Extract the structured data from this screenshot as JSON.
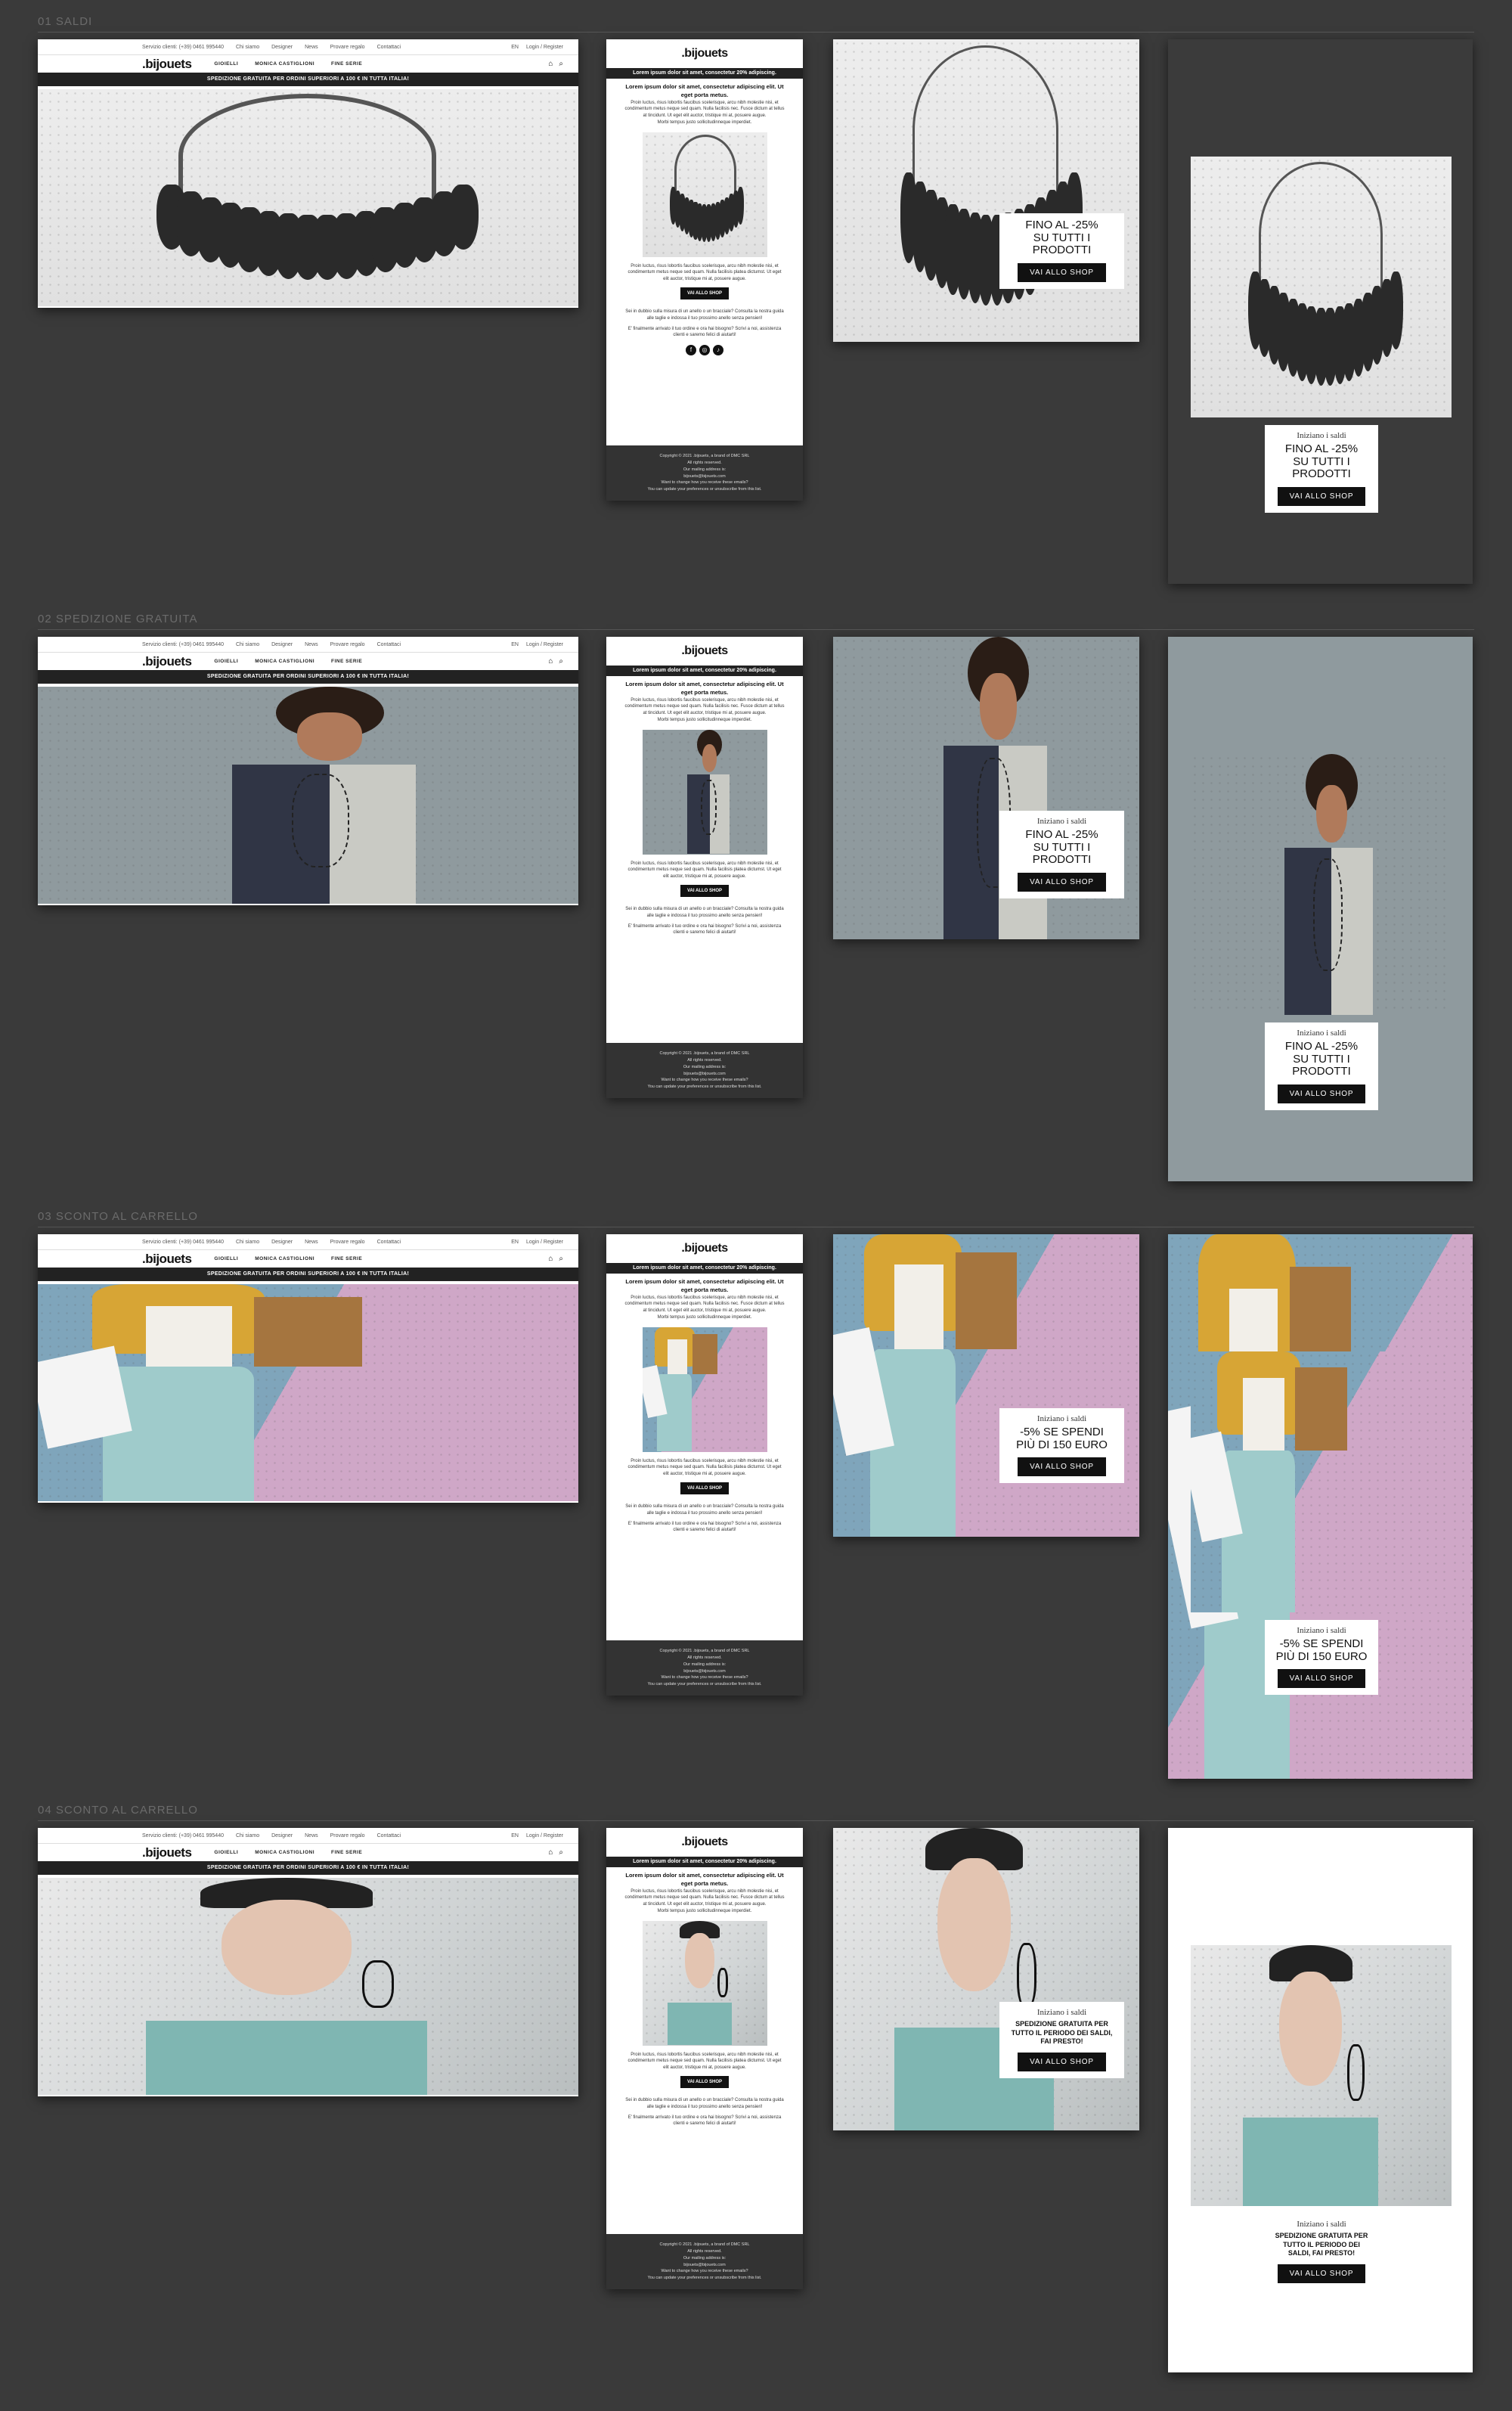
{
  "sections": [
    {
      "title": "01 SALDI"
    },
    {
      "title": "02 SPEDIZIONE GRATUITA"
    },
    {
      "title": "03 SCONTO AL CARRELLO"
    },
    {
      "title": "04 SCONTO AL CARRELLO"
    }
  ],
  "desktop": {
    "topbar": {
      "service": "Servizio clienti: (+39) 0461 995440",
      "links": [
        "Chi siamo",
        "Designer",
        "News",
        "Provare regalo",
        "Contattaci"
      ],
      "lang": "EN",
      "account": "Login / Register"
    },
    "logo": ".bijouets",
    "nav": [
      "GIOIELLI",
      "MONICA CASTIGLIONI",
      "FINE SERIE"
    ],
    "ship_bar": "SPEDIZIONE GRATUITA PER ORDINI SUPERIORI A 100 € IN TUTTA ITALIA!"
  },
  "email": {
    "logo": ".bijouets",
    "bar": "Lorem ipsum dolor sit amet, consectetur 20% adipiscing.",
    "lead": "Lorem ipsum dolor sit amet, consectetur adipiscing elit. Ut eget porta metus.",
    "p1": "Proin luctus, risus lobortis faucibus scelerisque, arcu nibh molestie nisi, et condimentum metus neque sed quam. Nulla facilisis nec. Fusce dictum at tellus at tincidunt. Ut eget elit auctor, tristique mi at, posuere augue.",
    "p2": "Morbi tempus justo sollicitudinneque imperdiet.",
    "p3": "Proin luctus, risus lobortis faucibus scelerisque, arcu nibh molestie nisi, et condimentum metus neque sed quam. Nulla facilisis platea dictumst. Ut eget elit auctor, tristique mi at, posuere augue.",
    "button": "VAI ALLO SHOP",
    "help": "Sei in dubbio sulla misura di un anello o un bracciale? Consulta la nostra guida alle taglie e indossa il tuo prossimo anello senza pensieri!",
    "note": "E' finalmente arrivato il tuo ordine e ora hai bisogno? Scrivi a noi, assistenza clienti e saremo felici di aiutarti!",
    "social": [
      "f",
      "◎",
      "♪"
    ],
    "footer": {
      "copyright": "Copyright © 2021 .bijouets, a brand of DMC SRL",
      "rights": "All rights reserved.",
      "mailing": "Our mailing address is:",
      "email": "bijouets@bijouets.com",
      "change": "Want to change how you receive these emails?",
      "update": "You can update your preferences or unsubscribe from this list."
    }
  },
  "promos": [
    {
      "inizio": "",
      "head": "FINO AL -25%",
      "sub": "SU TUTTI I PRODOTTI",
      "button": "VAI ALLO SHOP"
    },
    {
      "inizio": "Iniziano i saldi",
      "head": "FINO AL -25%",
      "sub": "SU TUTTI I PRODOTTI",
      "button": "VAI ALLO SHOP"
    },
    {
      "inizio": "Iniziano i saldi",
      "head": "FINO AL -25%",
      "sub": "SU TUTTI I PRODOTTI",
      "button": "VAI ALLO SHOP"
    },
    {
      "inizio": "Iniziano i saldi",
      "head": "FINO AL -25%",
      "sub": "SU TUTTI I PRODOTTI",
      "button": "VAI ALLO SHOP"
    },
    {
      "inizio": "Iniziano i saldi",
      "head": "-5% SE SPENDI",
      "sub": "PIÙ DI 150 EURO",
      "button": "VAI ALLO SHOP"
    },
    {
      "inizio": "Iniziano i saldi",
      "head": "-5% SE SPENDI",
      "sub": "PIÙ DI 150 EURO",
      "button": "VAI ALLO SHOP"
    },
    {
      "inizio": "Iniziano i saldi",
      "head": "SPEDIZIONE GRATUITA PER TUTTO IL PERIODO DEI SALDI, FAI PRESTO!",
      "sub": "",
      "button": "VAI ALLO SHOP"
    },
    {
      "inizio": "Iniziano i saldi",
      "head": "SPEDIZIONE GRATUITA PER TUTTO IL PERIODO DEI SALDI, FAI PRESTO!",
      "sub": "",
      "button": "VAI ALLO SHOP"
    }
  ],
  "colors": {
    "page_bg": "#3a3a3a",
    "dark": "#111111",
    "footer": "#333333",
    "pink": "#cfa7c7",
    "blue": "#7fa5bb",
    "slate": "#8f9a9e"
  }
}
